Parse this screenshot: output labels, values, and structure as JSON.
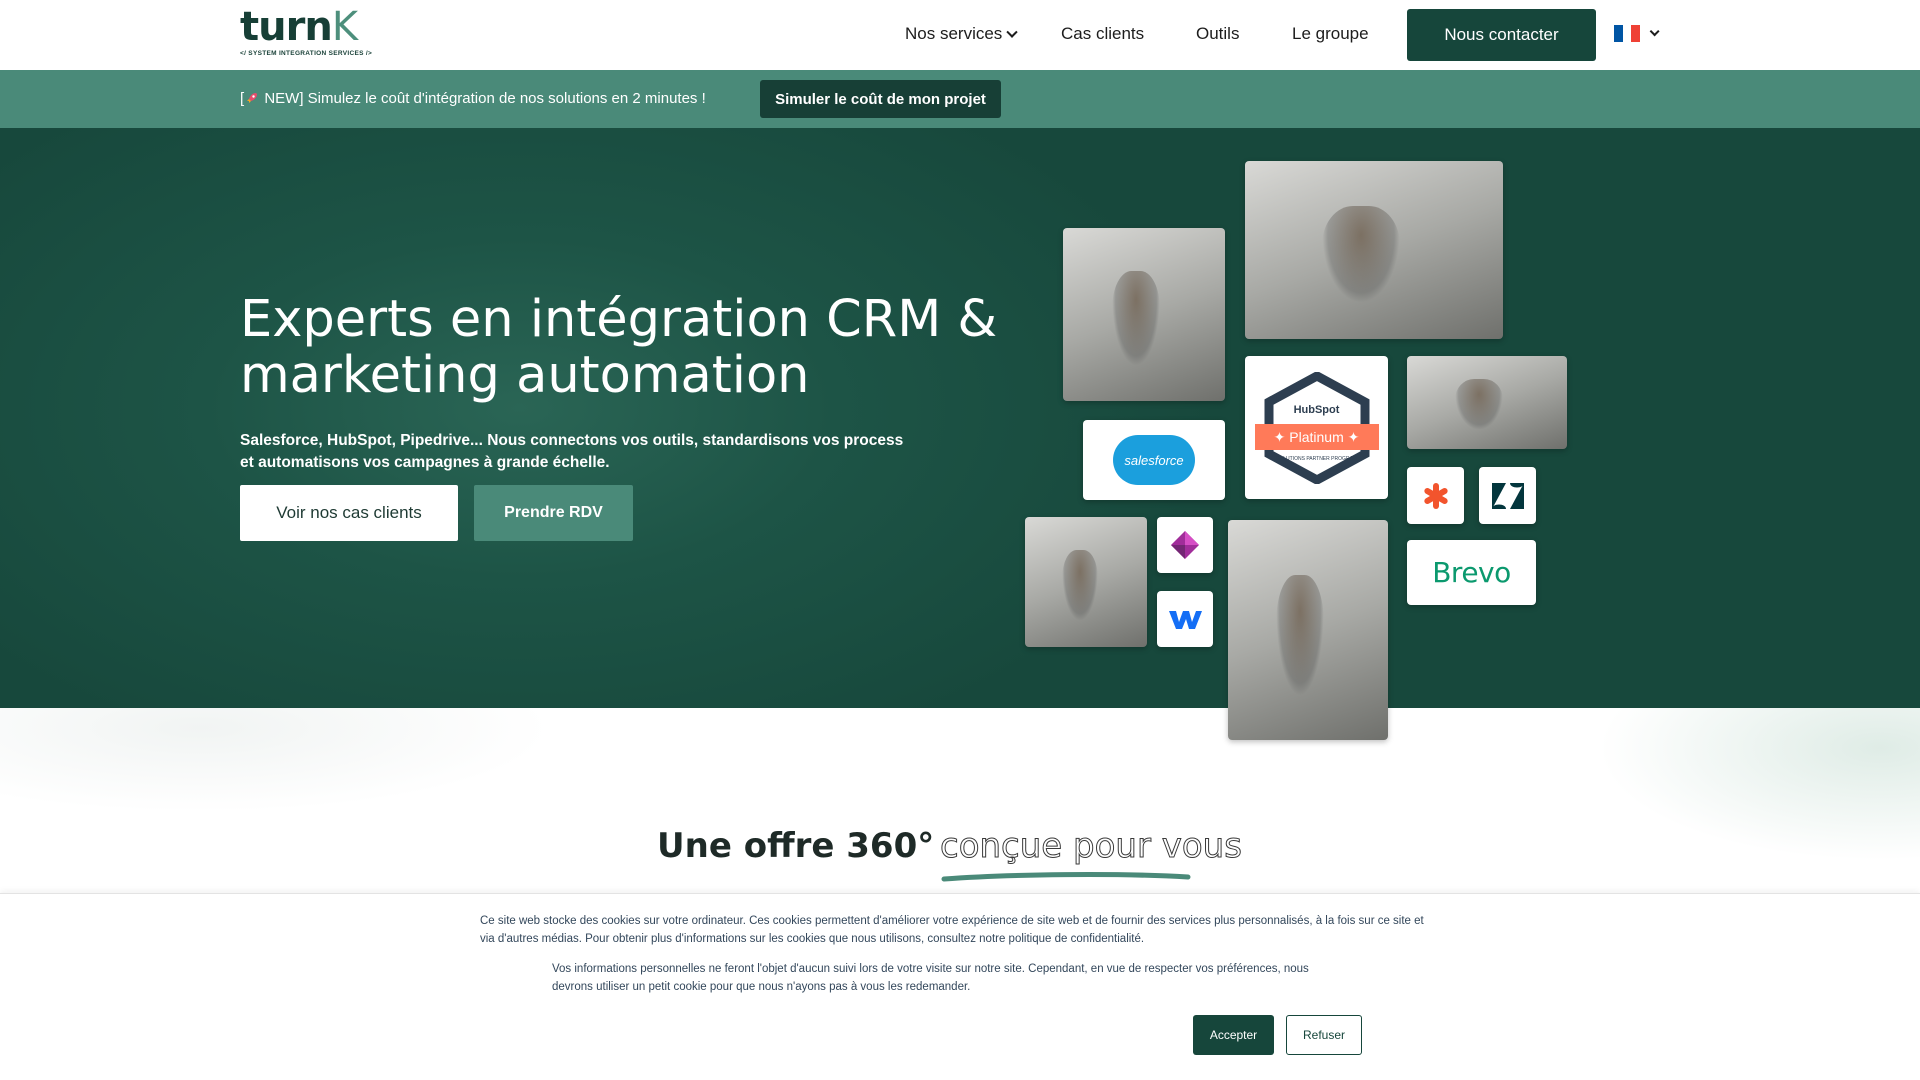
{
  "header": {
    "logo": {
      "word_main": "turn",
      "word_accent": "K",
      "tagline": "</ SYSTEM INTEGRATION SERVICES />"
    },
    "nav": [
      {
        "label": "Nos services",
        "has_dropdown": true
      },
      {
        "label": "Cas clients",
        "has_dropdown": false
      },
      {
        "label": "Outils",
        "has_dropdown": false
      },
      {
        "label": "Le groupe",
        "has_dropdown": false
      }
    ],
    "contact_label": "Nous contacter",
    "language": {
      "flag_icon": "france-flag-icon",
      "colors": [
        "#0055a4",
        "#ffffff",
        "#ef4135"
      ]
    }
  },
  "banner": {
    "text_before": "[",
    "icon": "rocket-icon",
    "text_after": " NEW] Simulez le coût d'intégration de nos solutions en 2 minutes !",
    "cta_label": "Simuler le coût de mon projet"
  },
  "hero": {
    "title": "Experts en intégration CRM & marketing automation",
    "subtitle": "Salesforce, HubSpot, Pipedrive... Nous connectons vos outils, standardisons vos process et automatisons vos campagnes à grande échelle.",
    "btn_cases": "Voir nos cas clients",
    "btn_rdv": "Prendre RDV",
    "logos": {
      "salesforce": "salesforce",
      "hubspot_brand": "HubSpot",
      "hubspot_tier": "Platinum",
      "hubspot_program": "SOLUTIONS PARTNER PROGRAM",
      "brevo": "Brevo"
    }
  },
  "section": {
    "title": "Une offre 360°",
    "title_accent": "conçue pour vous"
  },
  "cookie": {
    "paragraph1": "Ce site web stocke des cookies sur votre ordinateur. Ces cookies permettent d'améliorer votre expérience de site web et de fournir des services plus personnalisés, à la fois sur ce site et via d'autres médias. Pour obtenir plus d'informations sur les cookies que nous utilisons, consultez notre politique de confidentialité.",
    "paragraph2": "Vos informations personnelles ne feront l'objet d'aucun suivi lors de votre visite sur notre site. Cependant, en vue de respecter vos préférences, nous devrons utiliser un petit cookie pour que nous n'ayons pas à vous les redemander.",
    "accept_label": "Accepter",
    "refuse_label": "Refuser"
  },
  "colors": {
    "brand_dark": "#16463b",
    "brand_mid": "#4a8a79",
    "hero_bg": "#1d5446",
    "hubspot_orange": "#ff7a59",
    "salesforce_blue": "#1b9fdd",
    "brevo_green": "#0b996e"
  }
}
